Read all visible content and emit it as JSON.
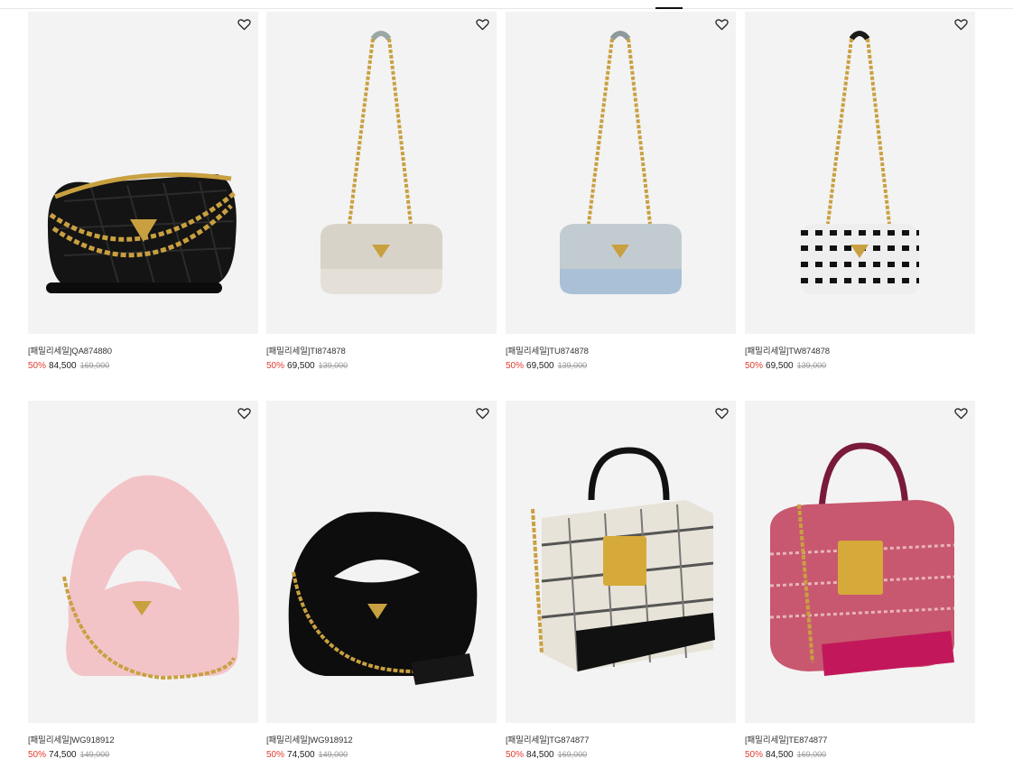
{
  "products": [
    {
      "name": "[패밀리세일]QA874880",
      "discount": "50%",
      "sale_price": "84,500",
      "original_price": "169,000"
    },
    {
      "name": "[패밀리세일]TI874878",
      "discount": "50%",
      "sale_price": "69,500",
      "original_price": "139,000"
    },
    {
      "name": "[패밀리세일]TU874878",
      "discount": "50%",
      "sale_price": "69,500",
      "original_price": "139,000"
    },
    {
      "name": "[패밀리세일]TW874878",
      "discount": "50%",
      "sale_price": "69,500",
      "original_price": "139,000"
    },
    {
      "name": "[패밀리세일]WG918912",
      "discount": "50%",
      "sale_price": "74,500",
      "original_price": "149,000"
    },
    {
      "name": "[패밀리세일]WG918912",
      "discount": "50%",
      "sale_price": "74,500",
      "original_price": "149,000"
    },
    {
      "name": "[패밀리세일]TG874877",
      "discount": "50%",
      "sale_price": "84,500",
      "original_price": "169,000"
    },
    {
      "name": "[패밀리세일]TE874877",
      "discount": "50%",
      "sale_price": "84,500",
      "original_price": "169,000"
    }
  ],
  "icons": {
    "wishlist": "heart-outline-icon"
  },
  "colors": {
    "discount": "#e33b2e",
    "image_bg": "#f3f3f3"
  }
}
